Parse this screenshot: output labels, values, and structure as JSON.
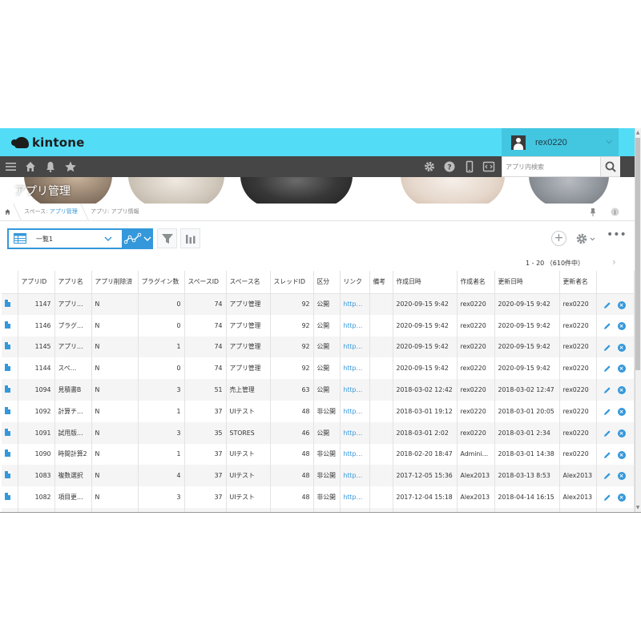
{
  "header": {
    "logo_text": "kintone",
    "username": "rex0220",
    "search_placeholder": "アプリ内検索"
  },
  "banner": {
    "title": "アプリ管理"
  },
  "breadcrumb": {
    "space_prefix": "スペース: ",
    "space_link": "アプリ管理",
    "app_prefix": "アプリ: ",
    "app_name": "アプリ情報"
  },
  "toolbar": {
    "view_name": "一覧1",
    "pagination": "1 - 20 （610件中）"
  },
  "table": {
    "columns": [
      "アプリID",
      "アプリ名",
      "アプリ削除済",
      "プラグイン数",
      "スペースID",
      "スペース名",
      "スレッドID",
      "区分",
      "リンク",
      "備考",
      "作成日時",
      "作成者名",
      "更新日時",
      "更新者名"
    ],
    "rows": [
      {
        "id": "1147",
        "name": "アプリ…",
        "deleted": "N",
        "plugins": "0",
        "space_id": "74",
        "space_name": "アプリ管理",
        "thread_id": "92",
        "kind": "公開",
        "link": "http…",
        "note": "",
        "created": "2020-09-15 9:42",
        "creator": "rex0220",
        "updated": "2020-09-15 9:42",
        "updater": "rex0220"
      },
      {
        "id": "1146",
        "name": "プラグ…",
        "deleted": "N",
        "plugins": "0",
        "space_id": "74",
        "space_name": "アプリ管理",
        "thread_id": "92",
        "kind": "公開",
        "link": "http…",
        "note": "",
        "created": "2020-09-15 9:42",
        "creator": "rex0220",
        "updated": "2020-09-15 9:42",
        "updater": "rex0220"
      },
      {
        "id": "1145",
        "name": "アプリ…",
        "deleted": "N",
        "plugins": "1",
        "space_id": "74",
        "space_name": "アプリ管理",
        "thread_id": "92",
        "kind": "公開",
        "link": "http…",
        "note": "",
        "created": "2020-09-15 9:42",
        "creator": "rex0220",
        "updated": "2020-09-15 9:42",
        "updater": "rex0220"
      },
      {
        "id": "1144",
        "name": "スペ…",
        "deleted": "N",
        "plugins": "0",
        "space_id": "74",
        "space_name": "アプリ管理",
        "thread_id": "92",
        "kind": "公開",
        "link": "http…",
        "note": "",
        "created": "2020-09-15 9:42",
        "creator": "rex0220",
        "updated": "2020-09-15 9:42",
        "updater": "rex0220"
      },
      {
        "id": "1094",
        "name": "見積書B",
        "deleted": "N",
        "plugins": "3",
        "space_id": "51",
        "space_name": "売上管理",
        "thread_id": "63",
        "kind": "公開",
        "link": "http…",
        "note": "",
        "created": "2018-03-02 12:42",
        "creator": "rex0220",
        "updated": "2018-03-02 12:47",
        "updater": "rex0220"
      },
      {
        "id": "1092",
        "name": "計算チ…",
        "deleted": "N",
        "plugins": "1",
        "space_id": "37",
        "space_name": "UIテスト",
        "thread_id": "48",
        "kind": "非公開",
        "link": "http…",
        "note": "",
        "created": "2018-03-01 19:12",
        "creator": "rex0220",
        "updated": "2018-03-01 20:05",
        "updater": "rex0220"
      },
      {
        "id": "1091",
        "name": "試用版…",
        "deleted": "N",
        "plugins": "3",
        "space_id": "35",
        "space_name": "STORES",
        "thread_id": "46",
        "kind": "公開",
        "link": "http…",
        "note": "",
        "created": "2018-03-01 2:02",
        "creator": "rex0220",
        "updated": "2018-03-01 2:34",
        "updater": "rex0220"
      },
      {
        "id": "1090",
        "name": "時間計算2",
        "deleted": "N",
        "plugins": "1",
        "space_id": "37",
        "space_name": "UIテスト",
        "thread_id": "48",
        "kind": "非公開",
        "link": "http…",
        "note": "",
        "created": "2018-02-20 18:47",
        "creator": "Admini…",
        "updated": "2018-03-01 14:38",
        "updater": "rex0220"
      },
      {
        "id": "1083",
        "name": "複数選択",
        "deleted": "N",
        "plugins": "4",
        "space_id": "37",
        "space_name": "UIテスト",
        "thread_id": "48",
        "kind": "非公開",
        "link": "http…",
        "note": "",
        "created": "2017-12-05 15:36",
        "creator": "Alex2013",
        "updated": "2018-03-13 8:53",
        "updater": "Alex2013"
      },
      {
        "id": "1082",
        "name": "項目更…",
        "deleted": "N",
        "plugins": "3",
        "space_id": "37",
        "space_name": "UIテスト",
        "thread_id": "48",
        "kind": "非公開",
        "link": "http…",
        "note": "",
        "created": "2017-12-04 15:18",
        "creator": "Alex2013",
        "updated": "2018-04-14 16:15",
        "updater": "Alex2013"
      },
      {
        "id": "",
        "name": "",
        "deleted": "",
        "plugins": "",
        "space_id": "",
        "space_name": "",
        "thread_id": "",
        "kind": "",
        "link": "",
        "note": "",
        "created": "",
        "creator": "",
        "updated": "",
        "updater": ""
      }
    ]
  },
  "colors": {
    "accent": "#3498db",
    "header": "#53dcf6",
    "nav": "#464646"
  }
}
